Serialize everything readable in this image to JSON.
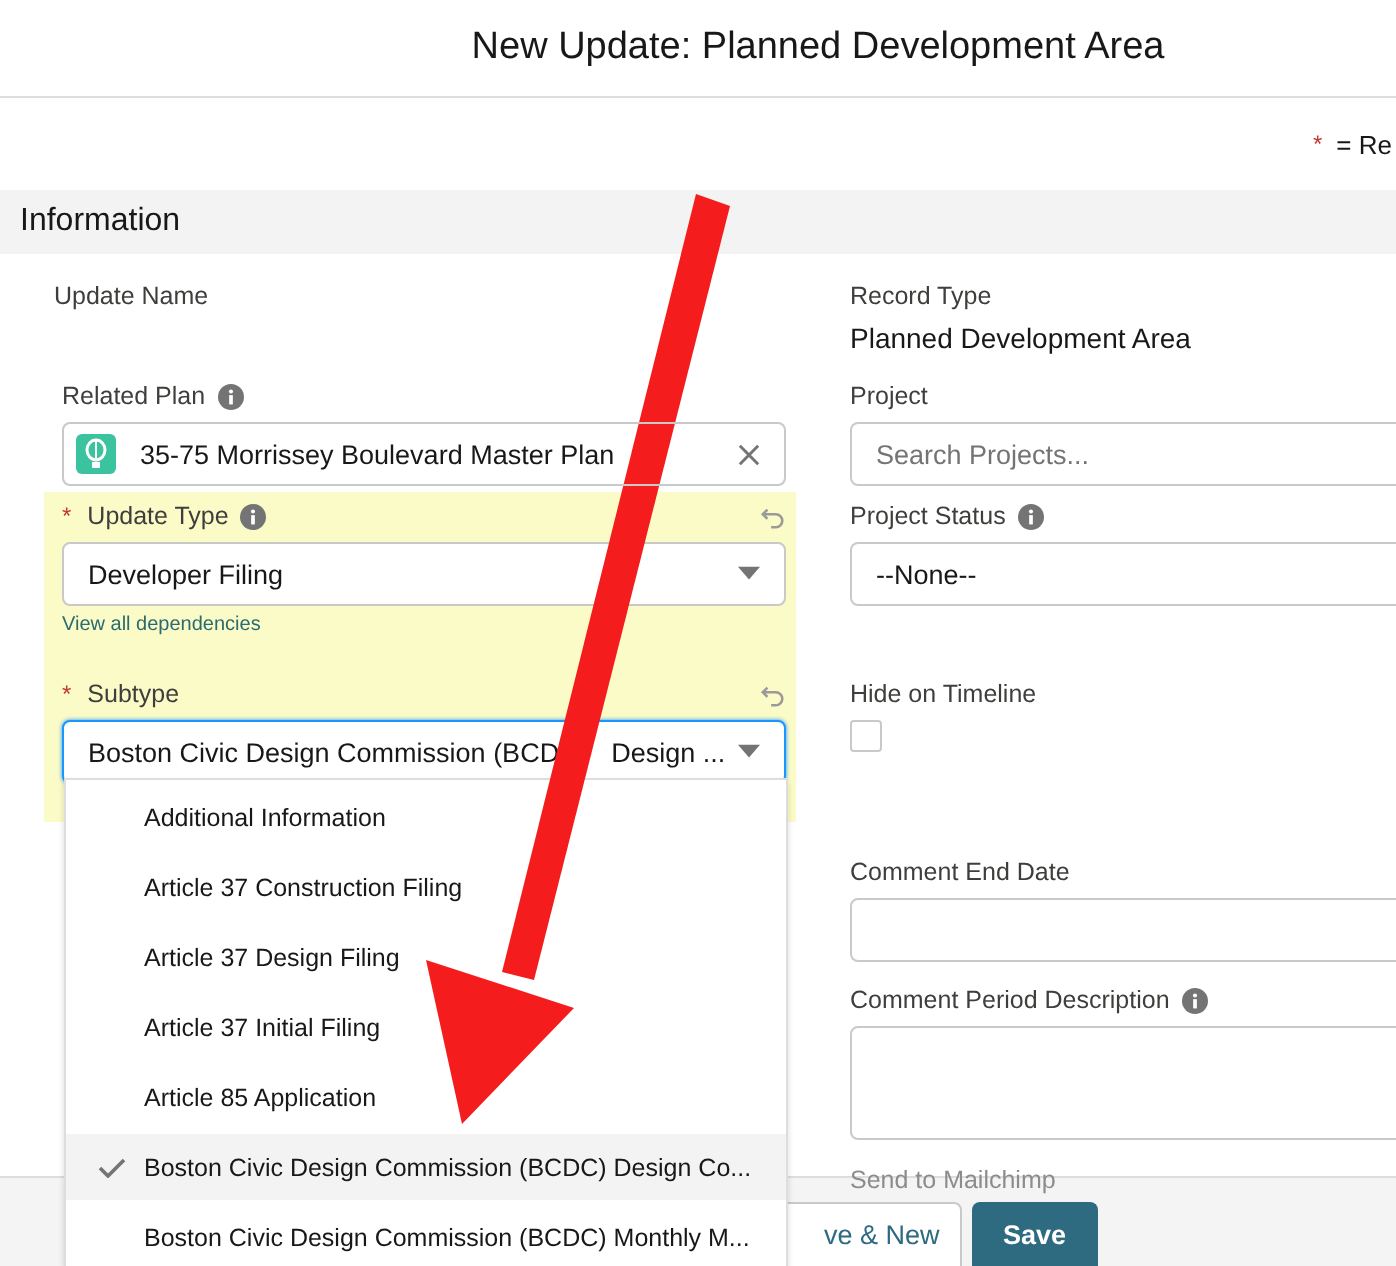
{
  "window": {
    "title": "New Update: Planned Development Area"
  },
  "required_legend": {
    "mark": "*",
    "text": "= Re"
  },
  "section": {
    "title": "Information"
  },
  "left_fields": [
    {
      "kind": "plain",
      "label": "Update Name",
      "required": false,
      "info": false,
      "undo": false,
      "highlighted": false
    },
    {
      "kind": "lookup",
      "label": "Related Plan",
      "required": false,
      "info": true,
      "undo": false,
      "highlighted": false,
      "value": "35-75 Morrissey Boulevard Master Plan"
    },
    {
      "kind": "select",
      "label": "Update Type",
      "required": true,
      "info": true,
      "undo": true,
      "highlighted": true,
      "value": "Developer Filing",
      "link": "View all dependencies",
      "focused": false
    },
    {
      "kind": "select",
      "label": "Subtype",
      "required": true,
      "info": false,
      "undo": true,
      "highlighted": true,
      "value": "Boston Civic Design Commission (BCD",
      "value_after": "Design ...",
      "focused": true
    }
  ],
  "right_fields": [
    {
      "kind": "readonly",
      "label": "Record Type",
      "info": false,
      "value": "Planned Development Area"
    },
    {
      "kind": "search",
      "label": "Project",
      "info": false,
      "placeholder": "Search Projects..."
    },
    {
      "kind": "select",
      "label": "Project Status",
      "info": true,
      "value": "--None--"
    },
    {
      "kind": "checkbox",
      "label": "Hide on Timeline",
      "info": false,
      "checked": false
    },
    {
      "kind": "input",
      "label": "Comment End Date",
      "info": false
    },
    {
      "kind": "textarea",
      "label": "Comment Period Description",
      "info": true
    },
    {
      "kind": "faded",
      "label": "Send to Mailchimp",
      "info": false
    }
  ],
  "dropdown": {
    "options": [
      {
        "label": "Additional Information",
        "selected": false
      },
      {
        "label": "Article 37 Construction Filing",
        "selected": false
      },
      {
        "label": "Article 37 Design Filing",
        "selected": false
      },
      {
        "label": "Article 37 Initial Filing",
        "selected": false
      },
      {
        "label": "Article 85 Application",
        "selected": false
      },
      {
        "label": "Boston Civic Design Commission (BCDC) Design Co...",
        "selected": true
      },
      {
        "label": "Boston Civic Design Commission (BCDC) Monthly M...",
        "selected": false
      }
    ]
  },
  "footer": {
    "buttons": [
      {
        "label": "ve & New",
        "kind": "neutral"
      },
      {
        "label": "Save",
        "kind": "brand"
      }
    ]
  }
}
